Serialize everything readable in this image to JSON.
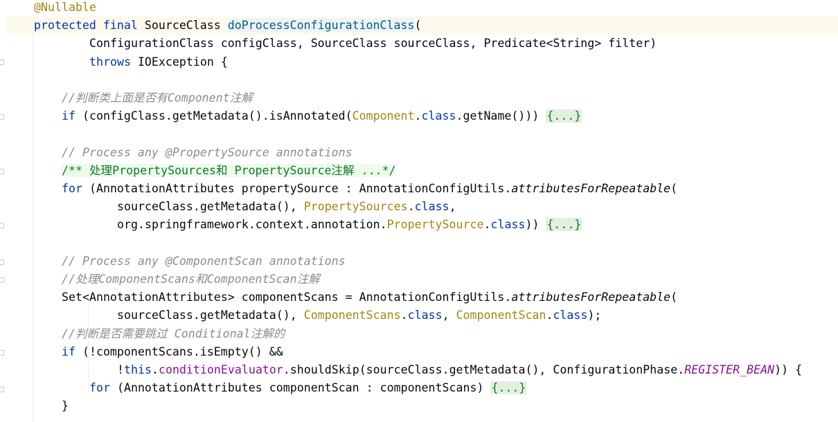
{
  "editor": {
    "lines": [
      {
        "indent": 1,
        "tokens": [
          {
            "t": "@Nullable",
            "c": "ann"
          }
        ]
      },
      {
        "indent": 1,
        "current": true,
        "tokens": [
          {
            "t": "protected",
            "c": "kw"
          },
          {
            "t": " "
          },
          {
            "t": "final",
            "c": "kw"
          },
          {
            "t": " SourceClass "
          },
          {
            "t": "doProcessConfigurationClass",
            "c": "def"
          },
          {
            "t": "("
          }
        ]
      },
      {
        "indent": 3,
        "tokens": [
          {
            "t": "ConfigurationClass configClass, SourceClass sourceClass, Predicate<String> filter)"
          }
        ]
      },
      {
        "indent": 3,
        "tokens": [
          {
            "t": "throws",
            "c": "kw"
          },
          {
            "t": " IOException {"
          }
        ]
      },
      {
        "indent": 0,
        "tokens": []
      },
      {
        "indent": 2,
        "tokens": [
          {
            "t": "//判断类上面是否有Component注解",
            "c": "comment"
          }
        ]
      },
      {
        "indent": 2,
        "tokens": [
          {
            "t": "if",
            "c": "kw"
          },
          {
            "t": " (configClass.getMetadata().isAnnotated("
          },
          {
            "t": "Component",
            "c": "type"
          },
          {
            "t": "."
          },
          {
            "t": "class",
            "c": "kw"
          },
          {
            "t": ".getName())) "
          },
          {
            "t": "{...}",
            "c": "fold"
          }
        ]
      },
      {
        "indent": 0,
        "tokens": []
      },
      {
        "indent": 2,
        "tokens": [
          {
            "t": "// Process any @PropertySource annotations",
            "c": "comment"
          }
        ]
      },
      {
        "indent": 2,
        "tokens": [
          {
            "t": "/** 处理PropertySources和 PropertySource注解 ...*/",
            "c": "doc"
          }
        ]
      },
      {
        "indent": 2,
        "tokens": [
          {
            "t": "for",
            "c": "kw"
          },
          {
            "t": " (AnnotationAttributes propertySource : AnnotationConfigUtils."
          },
          {
            "t": "attributesForRepeatable",
            "c": "italic"
          },
          {
            "t": "("
          }
        ]
      },
      {
        "indent": 4,
        "tokens": [
          {
            "t": "sourceClass.getMetadata(), "
          },
          {
            "t": "PropertySources",
            "c": "type"
          },
          {
            "t": "."
          },
          {
            "t": "class",
            "c": "kw"
          },
          {
            "t": ","
          }
        ]
      },
      {
        "indent": 4,
        "tokens": [
          {
            "t": "org.springframework.context.annotation."
          },
          {
            "t": "PropertySource",
            "c": "type"
          },
          {
            "t": "."
          },
          {
            "t": "class",
            "c": "kw"
          },
          {
            "t": ")) "
          },
          {
            "t": "{...}",
            "c": "fold"
          }
        ]
      },
      {
        "indent": 0,
        "tokens": []
      },
      {
        "indent": 2,
        "tokens": [
          {
            "t": "// Process any @ComponentScan annotations",
            "c": "comment"
          }
        ]
      },
      {
        "indent": 2,
        "tokens": [
          {
            "t": "//处理ComponentScans和ComponentScan注解",
            "c": "comment"
          }
        ]
      },
      {
        "indent": 2,
        "tokens": [
          {
            "t": "Set<AnnotationAttributes> componentScans = AnnotationConfigUtils."
          },
          {
            "t": "attributesForRepeatable",
            "c": "italic"
          },
          {
            "t": "("
          }
        ]
      },
      {
        "indent": 4,
        "tokens": [
          {
            "t": "sourceClass.getMetadata(), "
          },
          {
            "t": "ComponentScans",
            "c": "type"
          },
          {
            "t": "."
          },
          {
            "t": "class",
            "c": "kw"
          },
          {
            "t": ", "
          },
          {
            "t": "ComponentScan",
            "c": "type"
          },
          {
            "t": "."
          },
          {
            "t": "class",
            "c": "kw"
          },
          {
            "t": ");"
          }
        ]
      },
      {
        "indent": 2,
        "tokens": [
          {
            "t": "//判断是否需要跳过 Conditional注解的",
            "c": "comment"
          }
        ]
      },
      {
        "indent": 2,
        "tokens": [
          {
            "t": "if",
            "c": "kw"
          },
          {
            "t": " (!componentScans.isEmpty() &&"
          }
        ]
      },
      {
        "indent": 4,
        "tokens": [
          {
            "t": "!"
          },
          {
            "t": "this",
            "c": "kw"
          },
          {
            "t": "."
          },
          {
            "t": "conditionEvaluator",
            "c": "field"
          },
          {
            "t": ".shouldSkip(sourceClass.getMetadata(), ConfigurationPhase."
          },
          {
            "t": "REGISTER_BEAN",
            "c": "static"
          },
          {
            "t": ")) {"
          }
        ]
      },
      {
        "indent": 3,
        "tokens": [
          {
            "t": "for",
            "c": "kw"
          },
          {
            "t": " (AnnotationAttributes componentScan : componentScans) "
          },
          {
            "t": "{...}",
            "c": "fold"
          }
        ]
      },
      {
        "indent": 2,
        "tokens": [
          {
            "t": "}"
          }
        ]
      }
    ]
  },
  "colors": {
    "keyword": "#0033b3",
    "annotation": "#9e880d",
    "comment": "#8c8c8c",
    "doc_comment": "#0e7a2a",
    "field": "#871094",
    "method_decl": "#00627a",
    "current_line": "#fcfaed",
    "fold_bg": "#e3f0e0"
  }
}
